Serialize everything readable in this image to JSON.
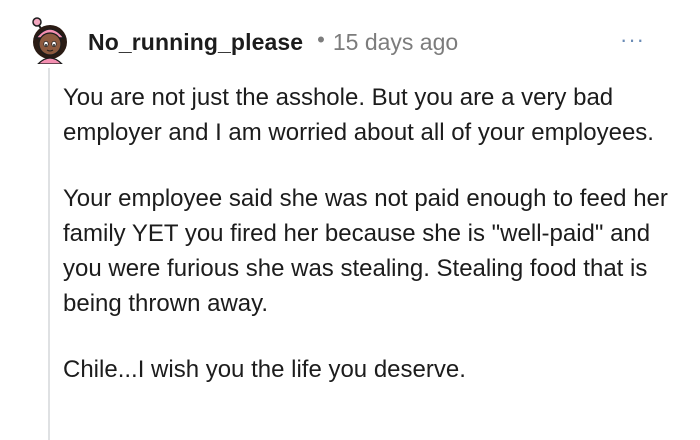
{
  "comment": {
    "username": "No_running_please",
    "separator": "•",
    "timestamp": "15 days ago",
    "more_label": "···",
    "paragraphs": [
      "You are not just the asshole. But you are a very bad employer and I am worried about all of your employees.",
      "Your employee said she was not paid enough to feed her family YET you fired her because she is \"well-paid\" and you were furious she was stealing. Stealing food that is being thrown away.",
      "Chile...I wish you the life you deserve."
    ]
  }
}
